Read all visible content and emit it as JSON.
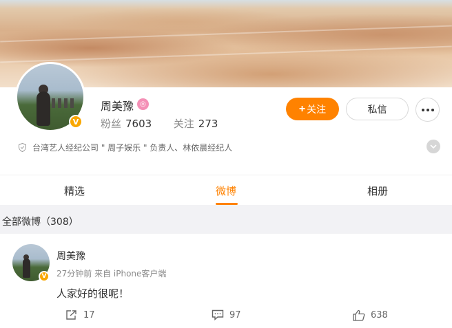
{
  "profile": {
    "name": "周美豫",
    "fans_label": "粉丝",
    "fans_count": "7603",
    "following_label": "关注",
    "following_count": "273",
    "follow_button": "关注",
    "message_button": "私信",
    "bio": "台湾艺人经纪公司 \" 周子娱乐 \" 负责人、林依晨经纪人",
    "verified_color": "#f9a700"
  },
  "tabs": [
    {
      "label": "精选",
      "active": false
    },
    {
      "label": "微博",
      "active": true
    },
    {
      "label": "相册",
      "active": false
    }
  ],
  "feed": {
    "all_label": "全部微博（308）"
  },
  "post": {
    "author": "周美豫",
    "meta": "27分钟前  来自 iPhone客户端",
    "text": "人家好的很呢！",
    "reposts": "17",
    "comments": "97",
    "likes": "638"
  },
  "colors": {
    "accent": "#ff8200",
    "background_bar": "#f2f2f5"
  }
}
